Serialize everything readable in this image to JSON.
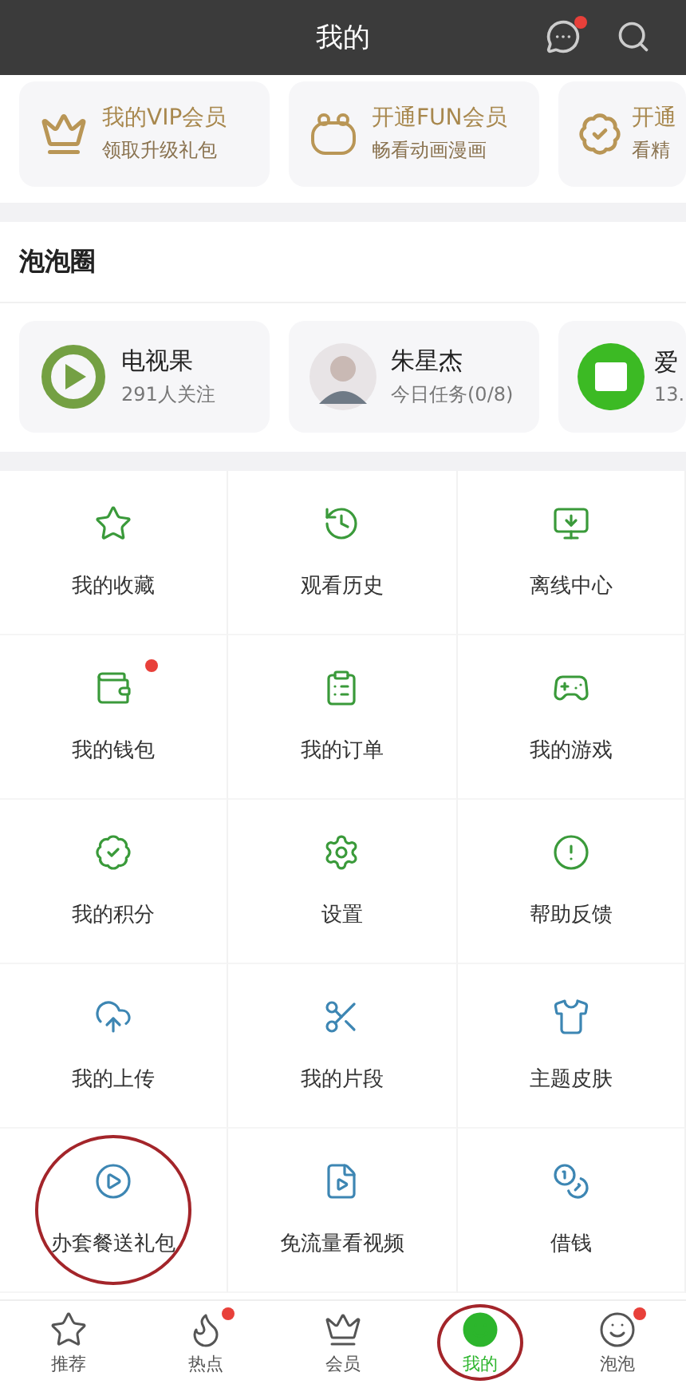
{
  "header": {
    "title": "我的",
    "message_badge": true
  },
  "vip_cards": [
    {
      "kind": "crown",
      "title": "我的VIP会员",
      "subtitle": "领取升级礼包"
    },
    {
      "kind": "fun",
      "title": "开通FUN会员",
      "subtitle": "畅看动画漫画"
    },
    {
      "kind": "medal",
      "title": "开通",
      "subtitle": "看精"
    }
  ],
  "circle_section": {
    "title": "泡泡圈"
  },
  "circles": [
    {
      "kind": "play",
      "name": "电视果",
      "info": "291人关注"
    },
    {
      "kind": "avatar",
      "name": "朱星杰",
      "info": "今日任务(0/8)"
    },
    {
      "kind": "film",
      "name": "爱",
      "info": "13."
    }
  ],
  "grid": [
    {
      "label": "我的收藏",
      "color": "#3a9a3a",
      "badge": false,
      "circled": false
    },
    {
      "label": "观看历史",
      "color": "#3a9a3a",
      "badge": false,
      "circled": false
    },
    {
      "label": "离线中心",
      "color": "#3a9a3a",
      "badge": false,
      "circled": false
    },
    {
      "label": "我的钱包",
      "color": "#3a9a3a",
      "badge": true,
      "circled": false
    },
    {
      "label": "我的订单",
      "color": "#3a9a3a",
      "badge": false,
      "circled": false
    },
    {
      "label": "我的游戏",
      "color": "#3a9a3a",
      "badge": false,
      "circled": false
    },
    {
      "label": "我的积分",
      "color": "#3a9a3a",
      "badge": false,
      "circled": false
    },
    {
      "label": "设置",
      "color": "#3a9a3a",
      "badge": false,
      "circled": false
    },
    {
      "label": "帮助反馈",
      "color": "#3a9a3a",
      "badge": false,
      "circled": false
    },
    {
      "label": "我的上传",
      "color": "#3d86b3",
      "badge": false,
      "circled": false
    },
    {
      "label": "我的片段",
      "color": "#3d86b3",
      "badge": false,
      "circled": false
    },
    {
      "label": "主题皮肤",
      "color": "#3d86b3",
      "badge": false,
      "circled": false
    },
    {
      "label": "办套餐送礼包",
      "color": "#3d86b3",
      "badge": false,
      "circled": true
    },
    {
      "label": "免流量看视频",
      "color": "#3d86b3",
      "badge": false,
      "circled": false
    },
    {
      "label": "借钱",
      "color": "#3d86b3",
      "badge": false,
      "circled": false
    }
  ],
  "tabs": [
    {
      "label": "推荐",
      "selected": false,
      "badge": false,
      "circled": false
    },
    {
      "label": "热点",
      "selected": false,
      "badge": true,
      "circled": false
    },
    {
      "label": "会员",
      "selected": false,
      "badge": false,
      "circled": false
    },
    {
      "label": "我的",
      "selected": true,
      "badge": false,
      "circled": true
    },
    {
      "label": "泡泡",
      "selected": false,
      "badge": true,
      "circled": false
    }
  ]
}
